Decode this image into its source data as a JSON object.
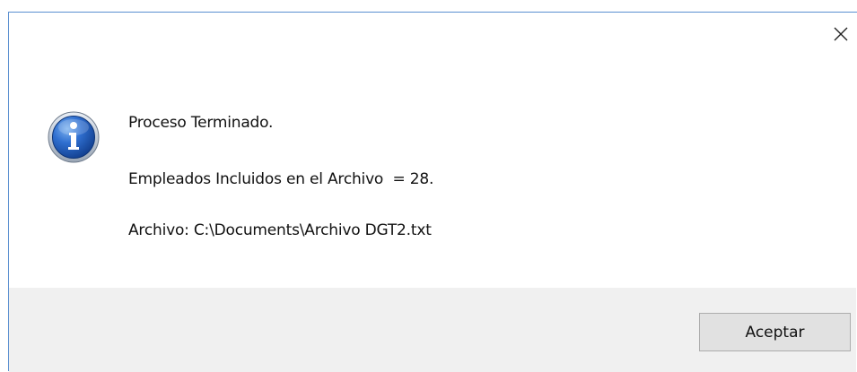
{
  "dialog": {
    "close_icon": "close-icon",
    "info_icon": "information-icon",
    "messages": [
      "Proceso Terminado.",
      "Empleados Incluidos en el Archivo  = 28.",
      "Archivo: C:\\Documents\\Archivo DGT2.txt"
    ],
    "ok_label": "Aceptar"
  },
  "colors": {
    "border": "#5a8fd0",
    "footer_bg": "#f0f0f0",
    "button_bg": "#e1e1e1",
    "button_border": "#adadad",
    "icon_blue": "#1e5bb8"
  }
}
